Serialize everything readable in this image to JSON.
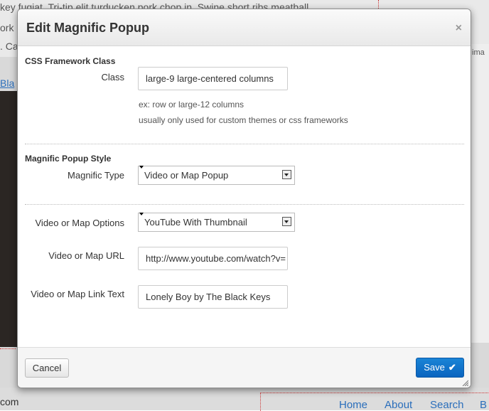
{
  "background": {
    "line1": "key fugiat. Tri-tip elit turducken pork chop in. Swine short ribs meatball",
    "line2": "ork",
    "line3": ". Ca",
    "link_fragment": "Bla",
    "right_label": "ima",
    "bottom_text": "com",
    "nav": [
      "Home",
      "About",
      "Search",
      "B"
    ]
  },
  "modal": {
    "title": "Edit Magnific Popup",
    "close_glyph": "×",
    "sections": {
      "css": {
        "title": "CSS Framework Class",
        "class_label": "Class",
        "class_value": "large-9 large-centered columns",
        "help1": "ex: row or large-12 columns",
        "help2": "usually only used for custom themes or css frameworks"
      },
      "style": {
        "title": "Magnific Popup Style",
        "type_label": "Magnific Type",
        "type_value": "Video or Map Popup"
      },
      "options": {
        "options_label": "Video or Map Options",
        "options_value": "YouTube With Thumbnail",
        "url_label": "Video or Map URL",
        "url_value": "http://www.youtube.com/watch?v=",
        "link_label": "Video or Map Link Text",
        "link_value": "Lonely Boy by The Black Keys"
      }
    },
    "footer": {
      "cancel": "Cancel",
      "save": "Save"
    }
  },
  "colors": {
    "save_button": "#0a64bf",
    "nav_link": "#2a6ebb"
  }
}
